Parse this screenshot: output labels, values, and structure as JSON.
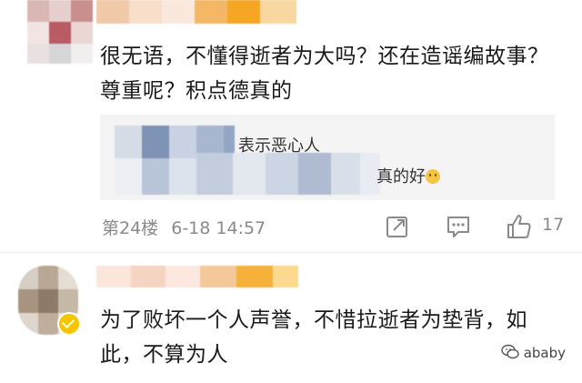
{
  "comment1": {
    "text_line1": "很无语，不懂得逝者为大吗？还在造谣编故事？",
    "text_line2": "尊重呢？积点德真的",
    "quote_line1_suffix": "表示恶心人",
    "quote_line2_suffix": "真的好",
    "floor": "第24楼",
    "time": "6-18 14:57",
    "like_count": "17"
  },
  "comment2": {
    "text_line1": "为了败坏一个人声誉，不惜拉逝者为垫背，如",
    "text_line2": "此，不算为人"
  },
  "watermark": {
    "label": "ababy"
  },
  "icons": [
    "share-icon",
    "comment-icon",
    "like-thumb-icon",
    "verified-badge-icon",
    "wechat-icon",
    "smile-emoji-icon"
  ],
  "colors": {
    "meta_gray": "#8a8a8a",
    "quote_bg": "#f4f4f4",
    "badge_yellow": "#f7c500"
  }
}
